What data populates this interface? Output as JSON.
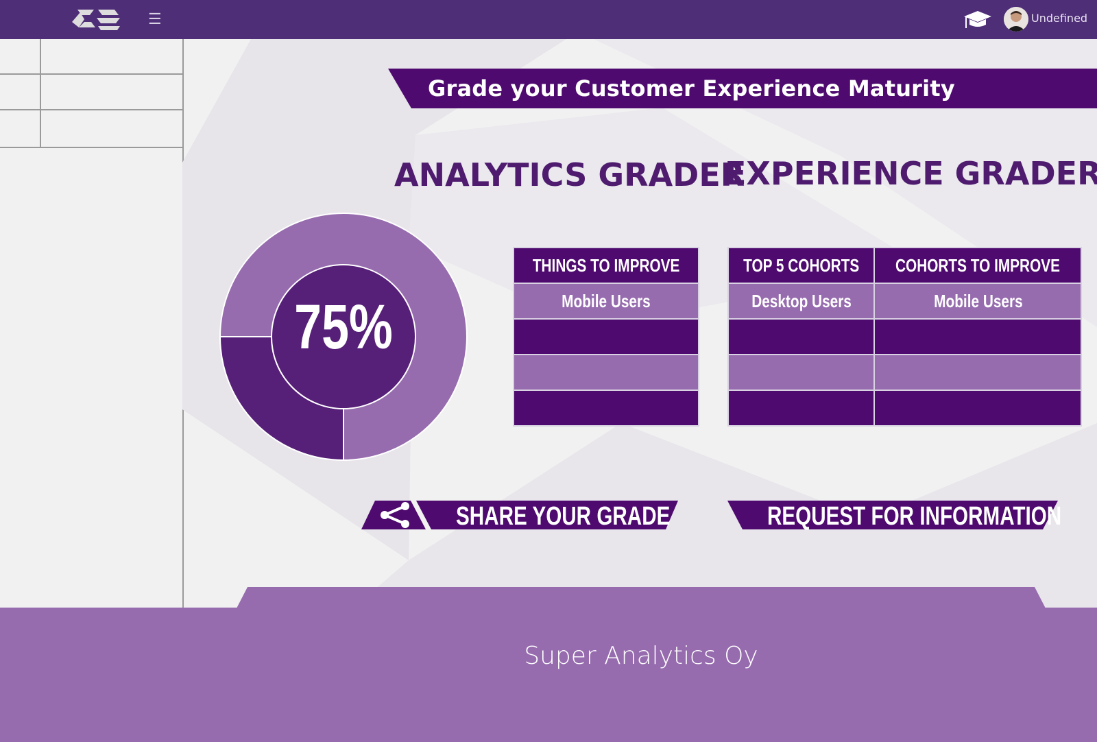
{
  "topbar": {
    "menu_icon": "hamburger-menu-icon",
    "user_name": "Undefined",
    "colors": {
      "bar": "#4e2e77"
    }
  },
  "banner": {
    "title": "Grade your Customer Experience Maturity"
  },
  "analytics": {
    "heading": "ANALYTICS GRADER",
    "score_label": "75%",
    "score": 0.75,
    "things_header": "THINGS TO IMPROVE",
    "things": [
      "Mobile Users",
      "",
      "",
      ""
    ]
  },
  "experience": {
    "heading": "EXPERIENCE GRADER",
    "col1_header": "TOP 5 COHORTS",
    "col2_header": "COHORTS TO IMPROVE",
    "rows": [
      [
        "Desktop Users",
        "Mobile Users"
      ],
      [
        "",
        ""
      ],
      [
        "",
        ""
      ],
      [
        "",
        ""
      ]
    ]
  },
  "actions": {
    "share_label": "SHARE YOUR GRADE",
    "share_icon": "share-icon",
    "request_label": "REQUEST FOR INFORMATION"
  },
  "footer": {
    "company": "Super Analytics Oy"
  },
  "colors": {
    "dark_purple": "#4e0a6e",
    "mid_purple": "#561f78",
    "light_purple": "#966cae",
    "heading": "#4e1b6e"
  }
}
